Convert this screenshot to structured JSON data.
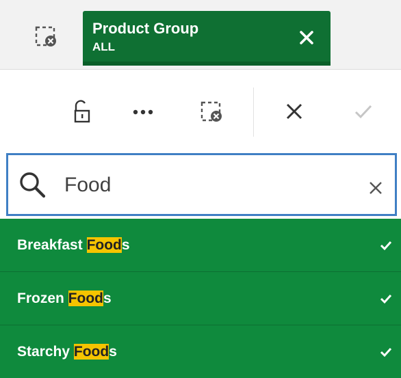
{
  "chip": {
    "title": "Product Group",
    "value": "ALL"
  },
  "search": {
    "value": "Food",
    "placeholder": "Search"
  },
  "list": {
    "items": [
      {
        "before": "Breakfast ",
        "match": "Food",
        "after": "s",
        "selected": true
      },
      {
        "before": "Frozen ",
        "match": "Food",
        "after": "s",
        "selected": true
      },
      {
        "before": "Starchy ",
        "match": "Food",
        "after": "s",
        "selected": true
      }
    ]
  },
  "colors": {
    "chip": "#0f7033",
    "row": "#0f8a3d",
    "highlight": "#f5c400",
    "search_border": "#3f7fc4"
  },
  "icons": [
    "clear-selections-icon",
    "close-icon",
    "lock-icon",
    "more-icon",
    "clear-selections-icon",
    "cancel-icon",
    "confirm-icon",
    "search-icon",
    "clear-icon",
    "check-icon"
  ]
}
